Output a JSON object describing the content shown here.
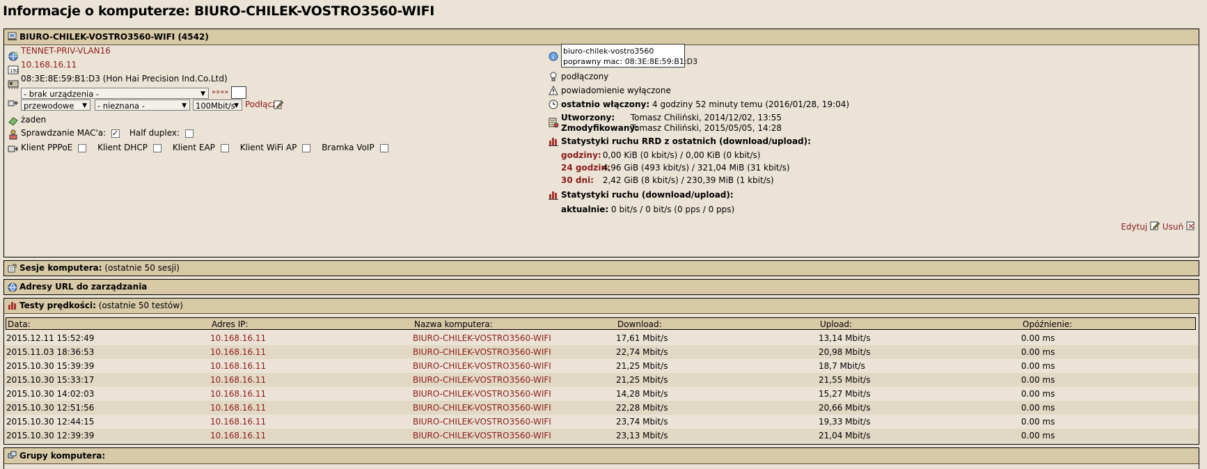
{
  "page": {
    "title": "Informacje o komputerze: BIURO-CHILEK-VOSTRO3560-WIFI"
  },
  "info_panel": {
    "header": "BIURO-CHILEK-VOSTRO3560-WIFI (4542)",
    "network": "TENNET-PRIV-VLAN16",
    "ip": "10.168.16.11",
    "mac": "08:3E:8E:59:B1:D3 (Hon Hai Precision Ind.Co.Ltd)",
    "device_select": "- brak urządzenia -",
    "arrow_link": "»»»»",
    "link_type": "przewodowe",
    "link_tech": "- nieznana -",
    "link_speed": "100Mbit/s",
    "connect_link": "Podłącz",
    "tariff": "żaden",
    "mac_check_label": "Sprawdzanie MAC'a:",
    "half_duplex_label": "Half duplex:",
    "flags": [
      "Klient PPPoE",
      "Klient DHCP",
      "Klient EAP",
      "Klient WiFi AP",
      "Bramka VoIP"
    ],
    "hostname_box": {
      "line1": "biuro-chilek-vostro3560",
      "line2": "poprawny mac: 08:3E:8E:59:B1:D3"
    },
    "status_connected": "podłączony",
    "notification": "powiadomienie wyłączone",
    "last_on_label": "ostatnio włączony:",
    "last_on_value": "4 godziny 52 minuty temu (2016/01/28, 19:04)",
    "created_label": "Utworzony:",
    "created_value": "Tomasz Chiliński, 2014/12/02, 13:55",
    "modified_label": "Zmodyfikowany:",
    "modified_value": "Tomasz Chiliński, 2015/05/05, 14:28",
    "rrd_title": "Statystyki ruchu RRD z ostatnich (download/upload):",
    "rrd": [
      {
        "label": "godziny:",
        "value": "0,00 KiB (0 kbit/s) / 0,00 KiB (0 kbit/s)"
      },
      {
        "label": "24 godzin:",
        "value": "4,96 GiB (493 kbit/s) / 321,04 MiB (31 kbit/s)"
      },
      {
        "label": "30 dni:",
        "value": "2,42 GiB (8 kbit/s) / 230,39 MiB (1 kbit/s)"
      }
    ],
    "traffic_title": "Statystyki ruchu (download/upload):",
    "current_label": "aktualnie:",
    "current_value": "0 bit/s / 0 bit/s (0 pps / 0 pps)",
    "edit_link": "Edytuj",
    "delete_link": "Usuń"
  },
  "sessions": {
    "label": "Sesje komputera:",
    "note": "(ostatnie 50 sesji)"
  },
  "urls": {
    "label": "Adresy URL do zarządzania"
  },
  "speedtests": {
    "label": "Testy prędkości:",
    "note": "(ostatnie 50 testów)",
    "columns": [
      "Data:",
      "Adres IP:",
      "Nazwa komputera:",
      "Download:",
      "Upload:",
      "Opóźnienie:"
    ],
    "rows": [
      [
        "2015.12.11 15:52:49",
        "10.168.16.11",
        "BIURO-CHILEK-VOSTRO3560-WIFI",
        "17,61 Mbit/s",
        "13,14 Mbit/s",
        "0.00 ms"
      ],
      [
        "2015.11.03 18:36:53",
        "10.168.16.11",
        "BIURO-CHILEK-VOSTRO3560-WIFI",
        "22,74 Mbit/s",
        "20,98 Mbit/s",
        "0.00 ms"
      ],
      [
        "2015.10.30 15:39:39",
        "10.168.16.11",
        "BIURO-CHILEK-VOSTRO3560-WIFI",
        "21,25 Mbit/s",
        "18,7 Mbit/s",
        "0.00 ms"
      ],
      [
        "2015.10.30 15:33:17",
        "10.168.16.11",
        "BIURO-CHILEK-VOSTRO3560-WIFI",
        "21,25 Mbit/s",
        "21,55 Mbit/s",
        "0.00 ms"
      ],
      [
        "2015.10.30 14:02:03",
        "10.168.16.11",
        "BIURO-CHILEK-VOSTRO3560-WIFI",
        "14,28 Mbit/s",
        "15,27 Mbit/s",
        "0.00 ms"
      ],
      [
        "2015.10.30 12:51:56",
        "10.168.16.11",
        "BIURO-CHILEK-VOSTRO3560-WIFI",
        "22,28 Mbit/s",
        "20,66 Mbit/s",
        "0.00 ms"
      ],
      [
        "2015.10.30 12:44:15",
        "10.168.16.11",
        "BIURO-CHILEK-VOSTRO3560-WIFI",
        "23,74 Mbit/s",
        "19,33 Mbit/s",
        "0.00 ms"
      ],
      [
        "2015.10.30 12:39:39",
        "10.168.16.11",
        "BIURO-CHILEK-VOSTRO3560-WIFI",
        "23,13 Mbit/s",
        "21,04 Mbit/s",
        "0.00 ms"
      ]
    ]
  },
  "groups": {
    "label": "Grupy komputera:"
  },
  "colors": {
    "background": "#ebe4d6",
    "header_bar": "#d8c9a7",
    "link_red": "#8b1a1a",
    "row_alt": "#e2d9c5"
  }
}
